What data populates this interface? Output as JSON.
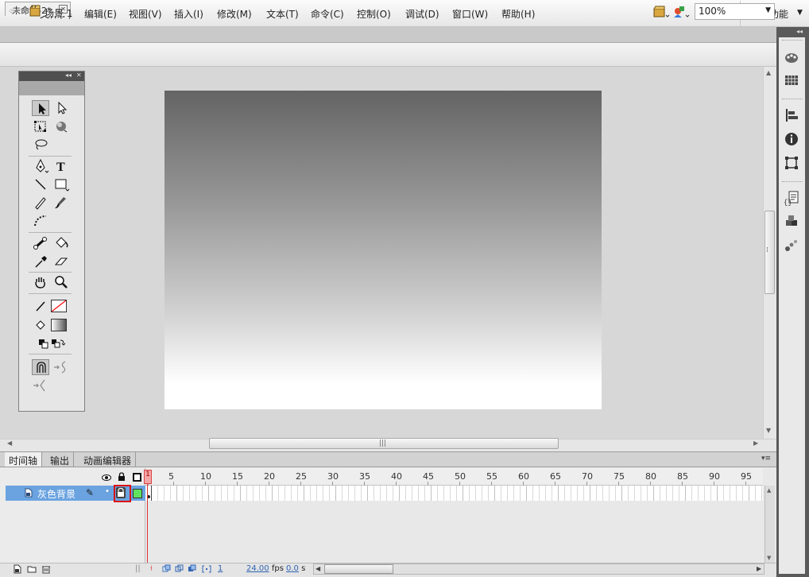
{
  "app": {
    "logo": "Fl"
  },
  "menu": {
    "items": [
      "文件(F)",
      "编辑(E)",
      "视图(V)",
      "插入(I)",
      "修改(M)",
      "文本(T)",
      "命令(C)",
      "控制(O)",
      "调试(D)",
      "窗口(W)",
      "帮助(H)"
    ],
    "workspace": "基本功能"
  },
  "document": {
    "tab_title": "未命名-2*",
    "close_glyph": "✕"
  },
  "edit_bar": {
    "back_glyph": "⇦",
    "scene_label": "场景 1",
    "zoom_value": "100%"
  },
  "stage": {
    "gradient_colors": [
      "#646464",
      "#ffffff"
    ]
  },
  "scrollbars": {
    "grip_glyph": "⁞",
    "grip_h": "|||"
  },
  "tools": {
    "panel_buttons": {
      "collapse": "◂◂",
      "close": "✕"
    },
    "items": [
      "selection-tool",
      "subselection-tool",
      "free-transform-tool",
      "3d-rotation-tool",
      "lasso-tool",
      "pen-tool",
      "text-tool",
      "line-tool",
      "rectangle-tool",
      "pencil-tool",
      "brush-tool",
      "deco-tool",
      "bone-tool",
      "paint-bucket-tool",
      "eyedropper-tool",
      "eraser-tool",
      "hand-tool",
      "zoom-tool",
      "stroke-color",
      "fill-color",
      "black-white-swatch",
      "swap-colors",
      "snap-to-objects",
      "smooth",
      "straighten"
    ],
    "stroke_color": "#ff0000",
    "text_tool_glyph": "T"
  },
  "timeline": {
    "tabs": [
      "时间轴",
      "输出",
      "动画编辑器"
    ],
    "frame_numbers": [
      "1",
      "5",
      "10",
      "15",
      "20",
      "25",
      "30",
      "35",
      "40",
      "45",
      "50",
      "55",
      "60",
      "65",
      "70",
      "75",
      "80",
      "85",
      "90",
      "95"
    ],
    "layer": {
      "name": "灰色背景",
      "color": "#5fe35f"
    },
    "current_frame": "1",
    "fps": "24.00",
    "fps_unit": "fps",
    "elapsed": "0.0",
    "elapsed_unit": "s",
    "menu_glyph": "▾≡"
  },
  "dock": {
    "icons": [
      "color-panel-icon",
      "swatches-panel-icon",
      "align-panel-icon",
      "info-panel-icon",
      "transform-panel-icon",
      "actions-panel-icon",
      "components-panel-icon",
      "motion-presets-icon"
    ],
    "collapse_glyph": "◂◂"
  }
}
